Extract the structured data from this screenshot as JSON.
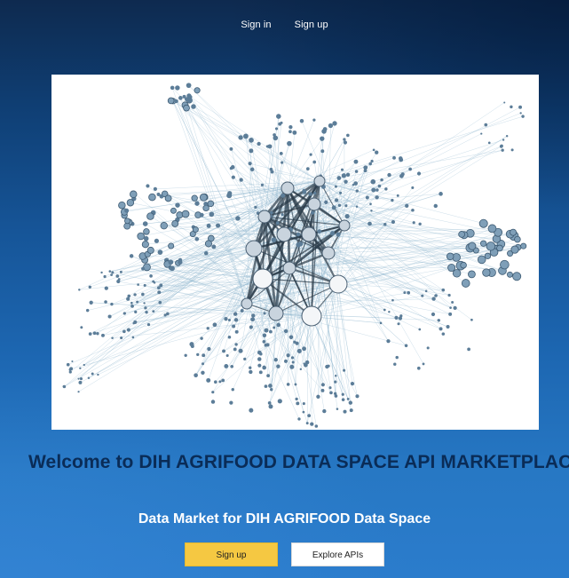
{
  "nav": {
    "sign_in": "Sign in",
    "sign_up": "Sign up"
  },
  "hero": {
    "image_icon": "network-graph-image"
  },
  "welcome": {
    "title": "Welcome to DIH AGRIFOOD DATA SPACE API MARKETPLACE"
  },
  "subtitle": {
    "text": "Data Market for DIH AGRIFOOD Data Space"
  },
  "cta": {
    "signup_label": "Sign up",
    "explore_label": "Explore APIs"
  },
  "colors": {
    "title_navy": "#0a2c57",
    "cta_yellow": "#f5c842",
    "node_fill": "#5c7d98",
    "edge": "#8fb6cf"
  }
}
